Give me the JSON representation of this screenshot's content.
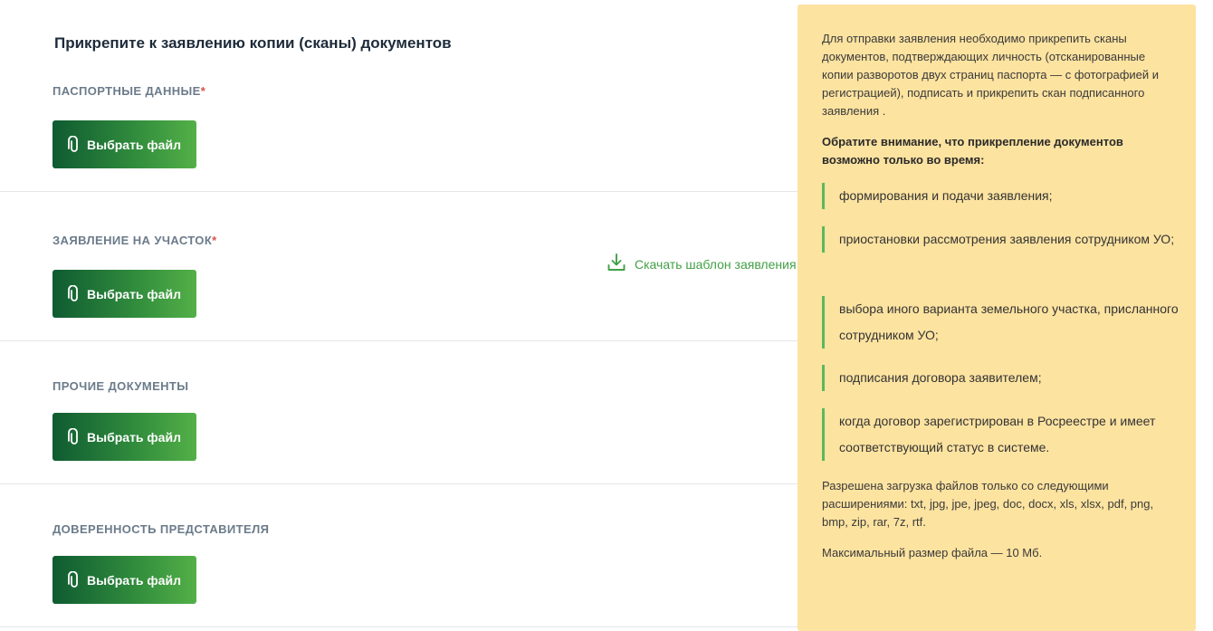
{
  "main": {
    "title": "Прикрепите к заявлению копии (сканы) документов",
    "sections": [
      {
        "label": "ПАСПОРТНЫЕ ДАННЫЕ",
        "required": "*",
        "button": "Выбрать файл"
      },
      {
        "label": "ЗАЯВЛЕНИЕ НА УЧАСТОК",
        "required": "*",
        "button": "Выбрать файл"
      },
      {
        "label": "ПРОЧИЕ ДОКУМЕНТЫ",
        "button": "Выбрать файл"
      },
      {
        "label": "ДОВЕРЕННОСТЬ ПРЕДСТАВИТЕЛЯ",
        "button": "Выбрать файл"
      }
    ],
    "download_template": "Скачать шаблон заявления"
  },
  "info": {
    "intro": "Для отправки заявления необходимо прикрепить сканы документов, подтверждающих личность (отсканированные копии разворотов двух страниц паспорта — с фотографией и регистрацией), подписать и прикрепить скан подписанного заявления .",
    "attention": "Обратите внимание, что прикрепление документов возможно только во время:",
    "bullets": [
      "формирования и подачи заявления;",
      "приостановки рассмотрения заявления сотрудником УО;",
      "выбора иного варианта земельного участка, присланного сотрудником УО;",
      "подписания договора заявителем;",
      "когда договор зарегистрирован в Росреестре и имеет соответствующий статус в системе."
    ],
    "extensions": "Разрешена загрузка файлов только со следующими расширениями: txt, jpg, jpe, jpeg, doc, docx, xls, xlsx, pdf, png, bmp, zip, rar, 7z, rtf.",
    "max_size": "Максимальный размер файла — 10 Мб."
  },
  "colors": {
    "accent_green": "#43a047",
    "button_gradient_start": "#0f5b31",
    "button_gradient_end": "#53b047",
    "info_background": "#fde3a0",
    "required_mark": "#d9534f"
  },
  "icons": {
    "file_button": "paperclip-icon",
    "download": "download-icon"
  }
}
